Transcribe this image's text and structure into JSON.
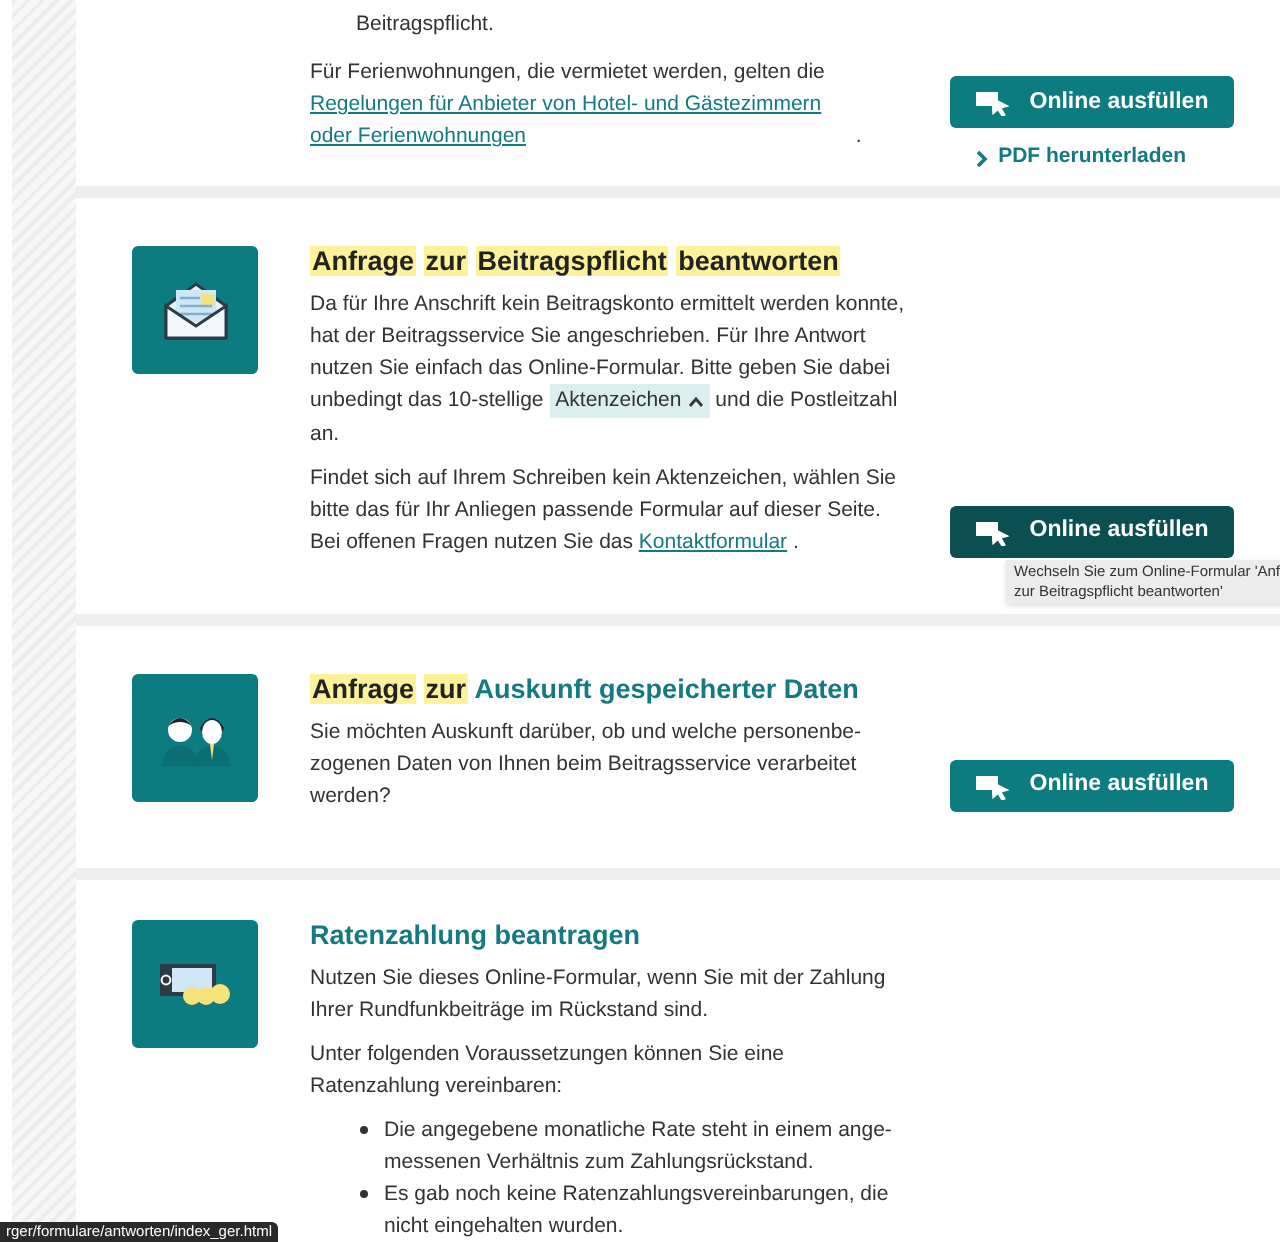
{
  "cards": [
    {
      "list_item_continuation": "Beitragspflicht.",
      "paragraphs": [
        [
          {
            "kind": "text",
            "text": "Für Ferienwohnungen, die vermietet werden, gelten die "
          },
          {
            "kind": "link",
            "text": "Regelungen für Anbieter von Hotel- und Gästezimmern oder Ferienwohnungen"
          },
          {
            "kind": "text",
            "text": " ."
          }
        ]
      ],
      "button": {
        "label": "Online ausfüllen",
        "hovered": false
      },
      "pdf_link": "PDF herunterladen"
    },
    {
      "title_parts": [
        {
          "text": "Anfrage",
          "highlighted": true
        },
        {
          "text": "zur",
          "highlighted": true
        },
        {
          "text": "Beitragspflicht",
          "highlighted": true
        },
        {
          "text": "beantworten",
          "highlighted": true
        }
      ],
      "paragraphs": [
        [
          {
            "kind": "text",
            "text": "Da für Ihre Anschrift kein Beitragskonto ermittelt werden konnte, hat der Beitragsservice Sie angeschrieben. Für Ihre Antwort nutzen Sie einfach das Online-Formular. Bitte geben Sie dabei unbedingt das 10-stellige "
          },
          {
            "kind": "term",
            "text": "Aktenzeichen"
          },
          {
            "kind": "text",
            "text": " und die Postleitzahl an."
          }
        ],
        [
          {
            "kind": "text",
            "text": "Findet sich auf Ihrem Schreiben kein Aktenzeichen, wählen Sie bitte das für Ihr Anliegen passende Formular auf dieser Seite. Bei offenen Fragen nutzen Sie das "
          },
          {
            "kind": "link",
            "text": "Kontaktformular"
          },
          {
            "kind": "text",
            "text": " ."
          }
        ]
      ],
      "button": {
        "label": "Online ausfüllen",
        "hovered": true
      },
      "tooltip": [
        "Wechseln Sie zum Online-Formular 'Anf",
        "zur Beitragspflicht beantworten'"
      ]
    },
    {
      "title_parts": [
        {
          "text": "Anfrage",
          "highlighted": true
        },
        {
          "text": "zur",
          "highlighted": true
        },
        {
          "text": "Auskunft",
          "highlighted": false
        },
        {
          "text": "gespeicherter",
          "highlighted": false
        },
        {
          "text": "Daten",
          "highlighted": false
        }
      ],
      "paragraphs": [
        [
          {
            "kind": "text",
            "text": "Sie möchten Auskunft darüber, ob und welche personenbe-zogenen Daten von Ihnen beim Beitragsservice verarbeitet werden?"
          }
        ]
      ],
      "button": {
        "label": "Online ausfüllen",
        "hovered": false
      }
    },
    {
      "title_parts": [
        {
          "text": "Ratenzahlung",
          "highlighted": false
        },
        {
          "text": "beantragen",
          "highlighted": false
        }
      ],
      "paragraphs": [
        [
          {
            "kind": "text",
            "text": "Nutzen Sie dieses Online-Formular, wenn Sie mit der Zahlung Ihrer Rundfunkbeiträge im Rückstand sind."
          }
        ],
        [
          {
            "kind": "text",
            "text": "Unter folgenden Voraussetzungen können Sie eine Ratenzahlung vereinbaren:"
          }
        ]
      ],
      "bullets": [
        "Die angegebene monatliche Rate steht in einem ange-messenen Verhältnis zum Zahlungsrückstand.",
        "Es gab noch keine Ratenzahlungsvereinbarungen, die nicht eingehalten wurden."
      ]
    }
  ],
  "status_bar": {
    "url": "rger/formulare/antworten/index_ger.html"
  }
}
